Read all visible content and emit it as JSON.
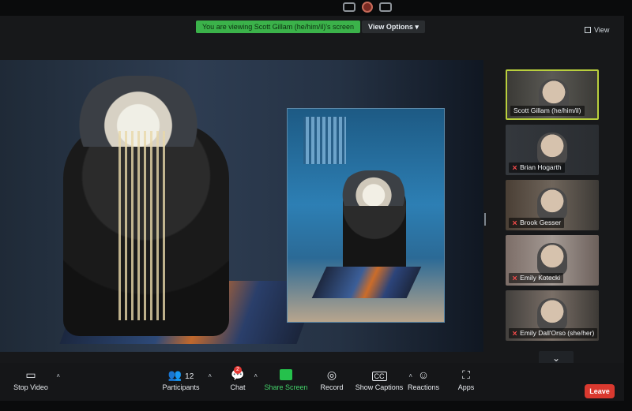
{
  "top": {
    "viewing_banner": "You are viewing Scott Gillam (he/him/il)'s screen",
    "view_options_label": "View Options",
    "view_label": "View"
  },
  "gallery": {
    "participants": [
      {
        "name": "Scott Gillam (he/him/il)",
        "muted": false,
        "active": true
      },
      {
        "name": "Brian Hogarth",
        "muted": true,
        "active": false
      },
      {
        "name": "Brook Gesser",
        "muted": true,
        "active": false
      },
      {
        "name": "Emily Kotecki",
        "muted": true,
        "active": false
      },
      {
        "name": "Emily Dall'Orso (she/her)",
        "muted": true,
        "active": false
      }
    ]
  },
  "toolbar": {
    "stop_video": "Stop Video",
    "participants": "Participants",
    "participants_count": "12",
    "chat": "Chat",
    "chat_badge": "2",
    "share_screen": "Share Screen",
    "record": "Record",
    "show_captions": "Show Captions",
    "captions_icon": "CC",
    "reactions": "Reactions",
    "apps": "Apps",
    "leave": "Leave"
  },
  "icons": {
    "video": "video-camera-icon",
    "participants": "people-icon",
    "chat": "chat-bubble-icon",
    "share": "share-screen-icon",
    "record": "record-icon",
    "captions": "captions-icon",
    "reactions": "reactions-icon",
    "apps": "apps-icon",
    "chevron_down": "chevron-down-icon"
  },
  "colors": {
    "viewing_banner": "#3bb24a",
    "active_speaker": "#b9cf3d",
    "leave": "#d9392f",
    "share_screen": "#43d36a"
  }
}
